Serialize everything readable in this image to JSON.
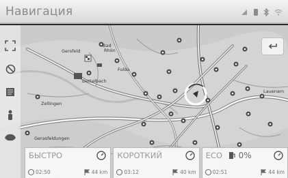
{
  "header": {
    "title": "Навигация"
  },
  "status_icons": [
    "signal-icon",
    "phone-icon",
    "bluetooth-icon",
    "wifi-icon"
  ],
  "map": {
    "labels": {
      "l1": "Gersfeld",
      "l2": "Bad",
      "l3": "Rhön",
      "l4": "Fulda",
      "l5": "Dettelbach",
      "l6": "Zellingen",
      "l7": "Lauenam",
      "l8": "Gerasfeldungen"
    }
  },
  "controls": {
    "back_icon": "return-arrow-icon",
    "left": [
      "zoom-extent-icon",
      "no-entry-icon",
      "map-options-icon",
      "person-icon",
      "layers-icon"
    ]
  },
  "routes": [
    {
      "name": "БЫСТРО",
      "time": "02:50",
      "dist": "44 km"
    },
    {
      "name": "КОРОТКИЙ",
      "time": "03:12",
      "dist": "40 km"
    },
    {
      "name": "ECO",
      "fuel": "0%",
      "time": "02:51",
      "dist": "44 km"
    }
  ]
}
